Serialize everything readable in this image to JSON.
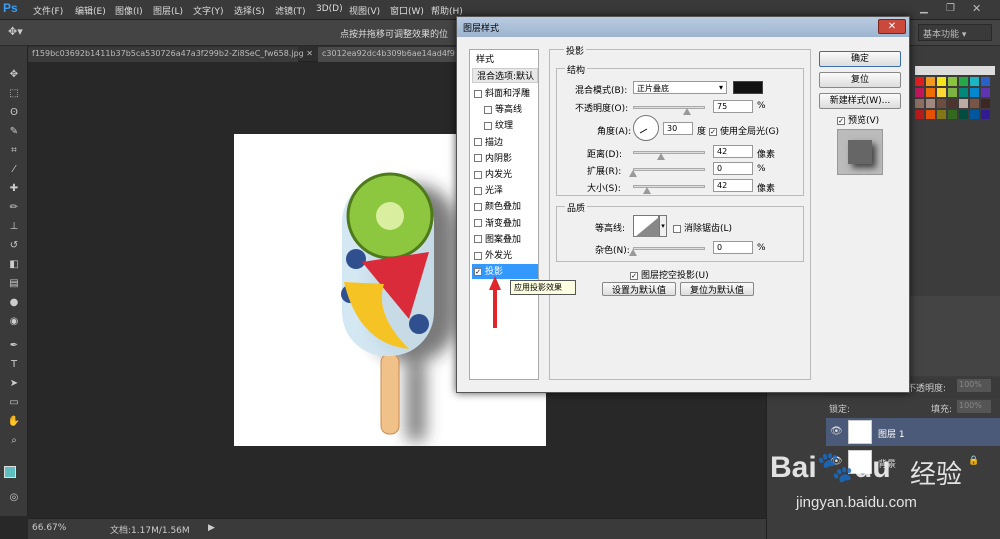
{
  "app": {
    "logo": "Ps"
  },
  "menu": [
    "文件(F)",
    "编辑(E)",
    "图像(I)",
    "图层(L)",
    "文字(Y)",
    "选择(S)",
    "滤镜(T)",
    "3D(D)",
    "视图(V)",
    "窗口(W)",
    "帮助(H)"
  ],
  "options": {
    "hint": "点按并拖移可调整效果的位",
    "workspace": "基本功能"
  },
  "tabs": [
    "f159bc03692b1411b37b5ca530726a47a3f299b2-Zi8SeC_fw658.jpg",
    "c3012ea92dc4b309b6ae14ad4f9"
  ],
  "status": {
    "zoom": "66.67%",
    "doc": "文档:1.17M/1.56M"
  },
  "dialog": {
    "title": "图层样式",
    "close": "✕",
    "style_header": "样式",
    "blend_default": "混合选项:默认",
    "style_items": [
      {
        "label": "斜面和浮雕",
        "checked": false,
        "indent": false
      },
      {
        "label": "等高线",
        "checked": false,
        "indent": true
      },
      {
        "label": "纹理",
        "checked": false,
        "indent": true
      },
      {
        "label": "描边",
        "checked": false,
        "indent": false
      },
      {
        "label": "内阴影",
        "checked": false,
        "indent": false
      },
      {
        "label": "内发光",
        "checked": false,
        "indent": false
      },
      {
        "label": "光泽",
        "checked": false,
        "indent": false
      },
      {
        "label": "颜色叠加",
        "checked": false,
        "indent": false
      },
      {
        "label": "渐变叠加",
        "checked": false,
        "indent": false
      },
      {
        "label": "图案叠加",
        "checked": false,
        "indent": false
      },
      {
        "label": "外发光",
        "checked": false,
        "indent": false
      },
      {
        "label": "投影",
        "checked": true,
        "indent": false
      }
    ],
    "section": "投影",
    "structure": "结构",
    "blend_mode_label": "混合模式(B):",
    "blend_mode_value": "正片叠底",
    "shadow_color": "#111111",
    "opacity_label": "不透明度(O):",
    "opacity_value": "75",
    "opacity_unit": "%",
    "angle_label": "角度(A):",
    "angle_value": "30",
    "angle_unit": "度",
    "global_light": "使用全局光(G)",
    "distance_label": "距离(D):",
    "distance_value": "42",
    "distance_unit": "像素",
    "spread_label": "扩展(R):",
    "spread_value": "0",
    "spread_unit": "%",
    "size_label": "大小(S):",
    "size_value": "42",
    "size_unit": "像素",
    "quality": "品质",
    "contour_label": "等高线:",
    "antialias": "消除锯齿(L)",
    "noise_label": "杂色(N):",
    "noise_value": "0",
    "noise_unit": "%",
    "knockout": "图层挖空投影(U)",
    "set_default": "设置为默认值",
    "reset_default": "复位为默认值",
    "ok": "确定",
    "reset": "复位",
    "new_style": "新建样式(W)...",
    "preview": "预览(V)",
    "tooltip": "应用投影效果"
  },
  "layers": {
    "opacity_label": "不透明度:",
    "opacity_value": "100%",
    "lock_label": "锁定:",
    "fill_label": "填充:",
    "fill_value": "100%",
    "layer1": "图层 1",
    "background": "背景"
  },
  "watermark": {
    "brand": "Bai",
    "brand2": "du",
    "cn": "经验",
    "url": "jingyan.baidu.com"
  }
}
